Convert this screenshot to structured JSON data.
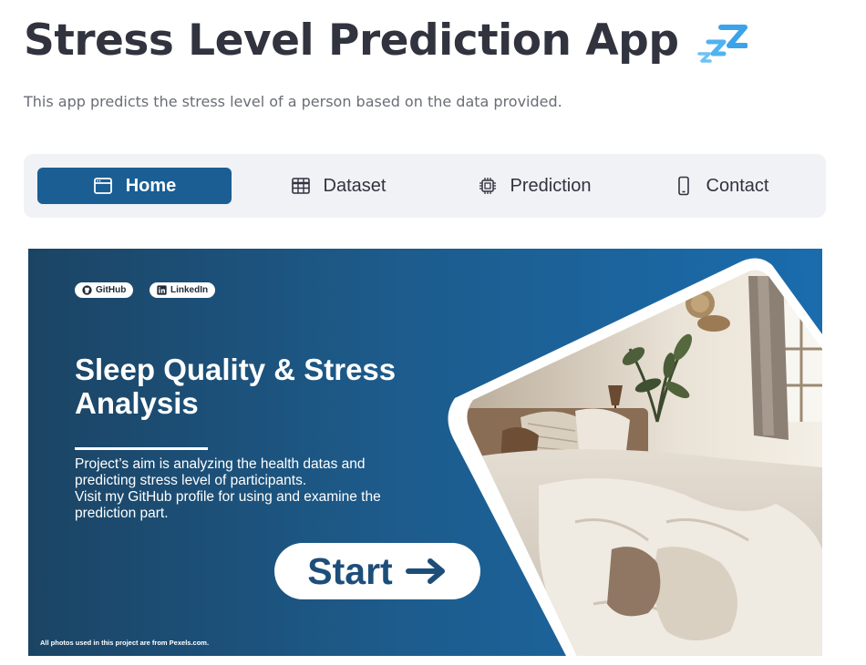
{
  "app": {
    "title": "Stress Level Prediction App",
    "title_icon": "zzz-emoji",
    "subtitle": "This app predicts the stress level of a person based on the data provided."
  },
  "nav": {
    "items": [
      {
        "label": "Home",
        "icon": "window-icon",
        "active": true
      },
      {
        "label": "Dataset",
        "icon": "table-icon",
        "active": false
      },
      {
        "label": "Prediction",
        "icon": "cpu-icon",
        "active": false
      },
      {
        "label": "Contact",
        "icon": "phone-icon",
        "active": false
      }
    ]
  },
  "banner": {
    "links": [
      {
        "label": "GitHub",
        "icon": "github-icon"
      },
      {
        "label": "LinkedIn",
        "icon": "linkedin-icon"
      }
    ],
    "title_line1": "Sleep Quality & Stress",
    "title_line2": "Analysis",
    "description": [
      "Project’s aim is analyzing the health datas and",
      "predicting stress level of participants.",
      "Visit my GitHub profile for using and examine the",
      "prediction part."
    ],
    "start_label": "Start",
    "footnote": "All photos used in this project are from Pexels.com.",
    "image": "bedroom-photo"
  },
  "colors": {
    "accent": "#1a5e94",
    "text": "#31333f",
    "subtitle": "#6a6d76",
    "navbar_bg": "#f0f2f6",
    "banner_dark": "#1b4464",
    "banner_light": "#1a6cad"
  }
}
